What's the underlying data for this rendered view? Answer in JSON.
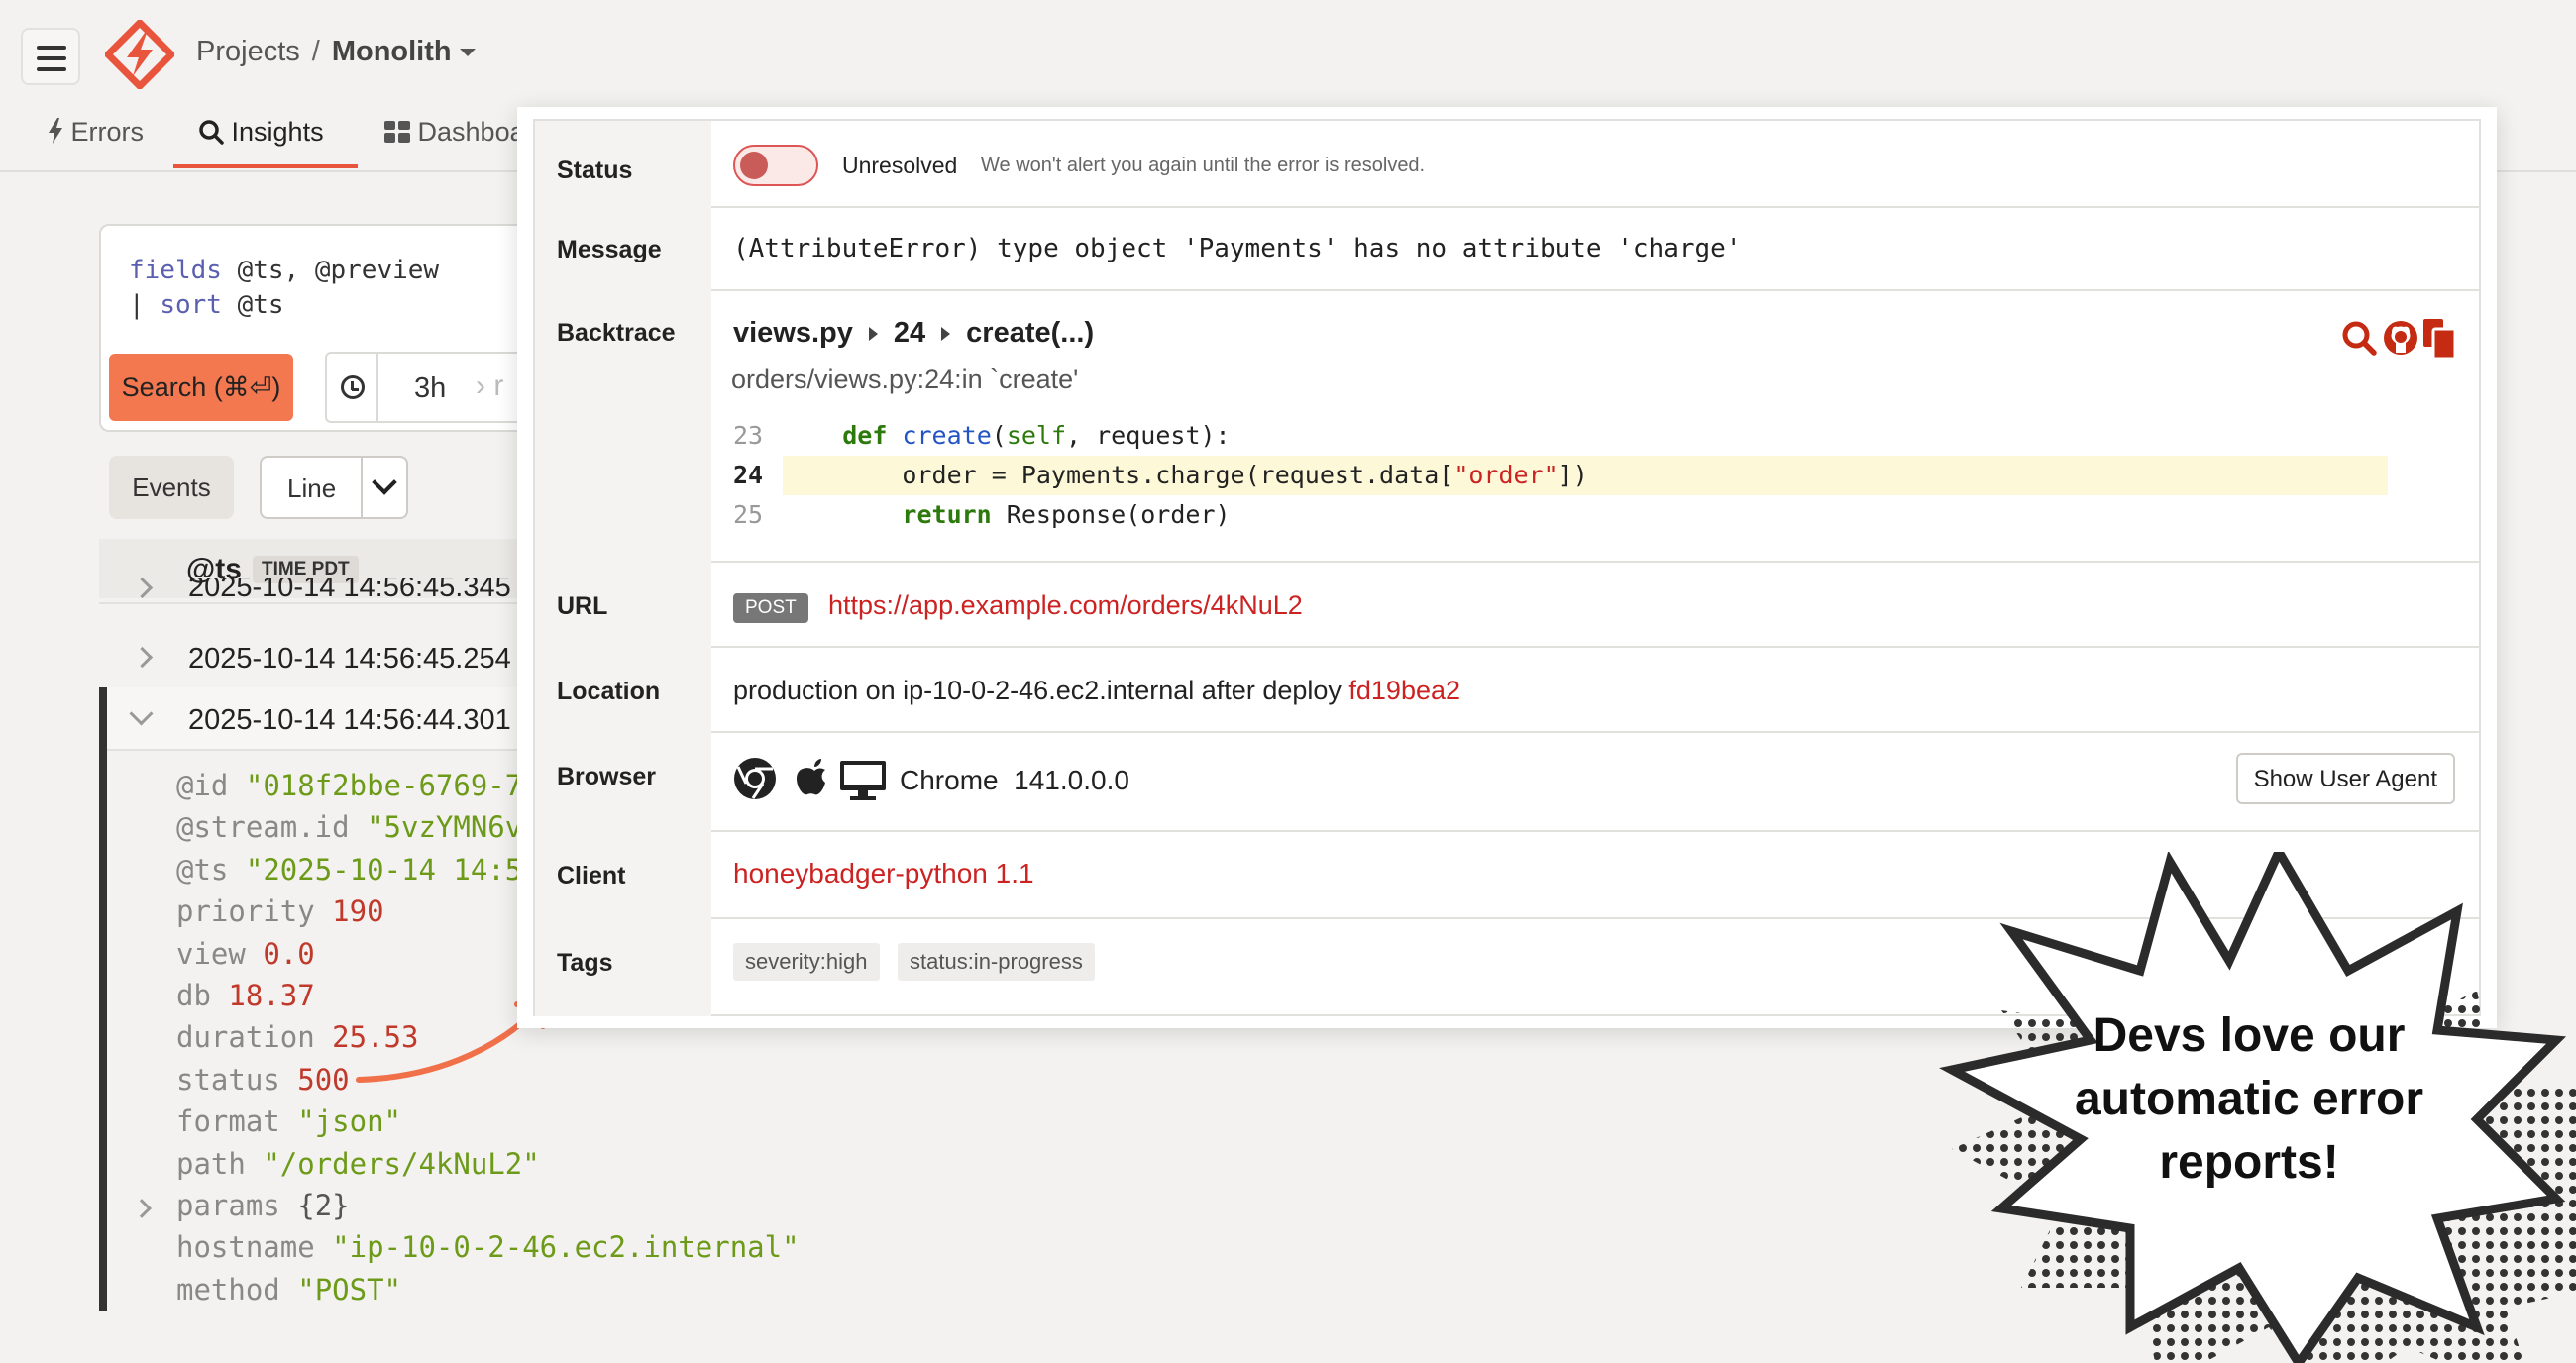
{
  "header": {
    "breadcrumb_root": "Projects",
    "breadcrumb_sep": "/",
    "project_name": "Monolith"
  },
  "nav": {
    "tabs": [
      {
        "label": "Errors",
        "icon": "bolt-icon"
      },
      {
        "label": "Insights",
        "icon": "search-icon",
        "active": true
      },
      {
        "label": "Dashboa",
        "icon": "dashboard-icon"
      }
    ]
  },
  "query": {
    "line1_kw": "fields",
    "line1_rest": " @ts, @preview",
    "line2_pipe": "| ",
    "line2_kw": "sort",
    "line2_rest": " @ts",
    "search_label": "Search (⌘⏎)",
    "time_range": "3h",
    "time_next": "› r"
  },
  "view": {
    "events_label": "Events",
    "line_label": "Line"
  },
  "results": {
    "ts_header": "@ts",
    "tz_badge": "TIME PDT",
    "rows": [
      {
        "ts": "2025-10-14 14:56:45.345"
      },
      {
        "ts": "2025-10-14 14:56:45.254"
      },
      {
        "ts": "2025-10-14 14:56:44.301"
      }
    ],
    "fields": [
      {
        "key": "@id",
        "val": "\"018f2bbe-6769-7",
        "type": "str"
      },
      {
        "key": "@stream.id",
        "val": "\"5vzYMN6v",
        "type": "str"
      },
      {
        "key": "@ts",
        "val": "\"2025-10-14 14:5",
        "type": "str"
      },
      {
        "key": "priority",
        "val": "190",
        "type": "num"
      },
      {
        "key": "view",
        "val": "0.0",
        "type": "num"
      },
      {
        "key": "db",
        "val": "18.37",
        "type": "num"
      },
      {
        "key": "duration",
        "val": "25.53",
        "type": "num"
      },
      {
        "key": "status",
        "val": "500",
        "type": "num"
      },
      {
        "key": "format",
        "val": "\"json\"",
        "type": "str"
      },
      {
        "key": "path",
        "val": "\"/orders/4kNuL2\"",
        "type": "str"
      },
      {
        "key": "params",
        "val": "{2}",
        "type": "obj"
      },
      {
        "key": "hostname",
        "val": "\"ip-10-0-2-46.ec2.internal\"",
        "type": "str"
      },
      {
        "key": "method",
        "val": "\"POST\"",
        "type": "str"
      }
    ]
  },
  "error": {
    "labels": {
      "status": "Status",
      "message": "Message",
      "backtrace": "Backtrace",
      "url": "URL",
      "location": "Location",
      "browser": "Browser",
      "client": "Client",
      "tags": "Tags"
    },
    "status_text": "Unresolved",
    "status_help": "We won't alert you again until the error is resolved.",
    "message": "(AttributeError) type object 'Payments' has no attribute 'charge'",
    "backtrace": {
      "file": "views.py",
      "line": "24",
      "method": "create(...)",
      "subtitle": "orders/views.py:24:in `create'",
      "code": [
        {
          "ln": "23",
          "a": "    ",
          "def": "def",
          "b": " ",
          "fn": "create",
          "c": "(",
          "self": "self",
          "d": ", request):"
        },
        {
          "ln": "24",
          "pre": "        order = Payments.charge(request.data[",
          "str": "\"order\"",
          "post": "])"
        },
        {
          "ln": "25",
          "pre": "        ",
          "kw": "return",
          "post": " Response(order)"
        }
      ]
    },
    "url_method": "POST",
    "url": "https://app.example.com/orders/4kNuL2",
    "location_text": "production  on  ip-10-0-2-46.ec2.internal  after deploy ",
    "deploy": "fd19bea2",
    "browser_name": "Chrome",
    "browser_version": "141.0.0.0",
    "show_ua_label": "Show User Agent",
    "client": "honeybadger-python 1.1",
    "tags": [
      "severity:high",
      "status:in-progress"
    ]
  },
  "callout": {
    "line1": "Devs love our",
    "line2": "automatic error",
    "line3": "reports!"
  },
  "colors": {
    "brand": "#e8553c",
    "link": "#cc2222",
    "search_button": "#f4784f"
  }
}
